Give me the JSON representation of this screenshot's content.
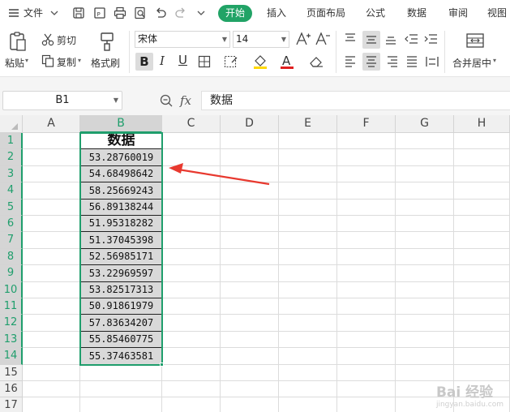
{
  "menubar": {
    "file_label": "文件",
    "tabs": [
      {
        "label": "开始",
        "active": true
      },
      {
        "label": "插入"
      },
      {
        "label": "页面布局"
      },
      {
        "label": "公式"
      },
      {
        "label": "数据"
      },
      {
        "label": "审阅"
      },
      {
        "label": "视图"
      }
    ]
  },
  "ribbon": {
    "paste_label": "粘贴",
    "cut_label": "剪切",
    "copy_label": "复制",
    "format_painter_label": "格式刷",
    "font_name": "宋体",
    "font_size": "14",
    "bold_label": "B",
    "italic_label": "I",
    "underline_label": "U",
    "font_color_label": "A",
    "merge_center_label": "合并居中",
    "accent_color": "#21a366",
    "font_color_bar": "#e02020",
    "fill_color_bar": "#ffd800"
  },
  "formula_bar": {
    "name_box": "B1",
    "fx_label": "fx",
    "content": "数据"
  },
  "sheet": {
    "columns": [
      "A",
      "B",
      "C",
      "D",
      "E",
      "F",
      "G",
      "H"
    ],
    "rows": [
      "1",
      "2",
      "3",
      "4",
      "5",
      "6",
      "7",
      "8",
      "9",
      "10",
      "11",
      "12",
      "13",
      "14",
      "15",
      "16",
      "17"
    ],
    "selected_column": "B",
    "header_cell": "数据",
    "values": [
      "53.28760019",
      "54.68498642",
      "58.25669243",
      "56.89138244",
      "51.95318282",
      "51.37045398",
      "52.56985171",
      "53.22969597",
      "53.82517313",
      "50.91861979",
      "57.83634207",
      "55.85460775",
      "55.37463581"
    ],
    "selection_color": "#1f9e6c",
    "annotation_arrow_color": "#e8392f"
  },
  "watermark": {
    "text": "Bai 经验",
    "subtext": "jingyan.baidu.com"
  }
}
